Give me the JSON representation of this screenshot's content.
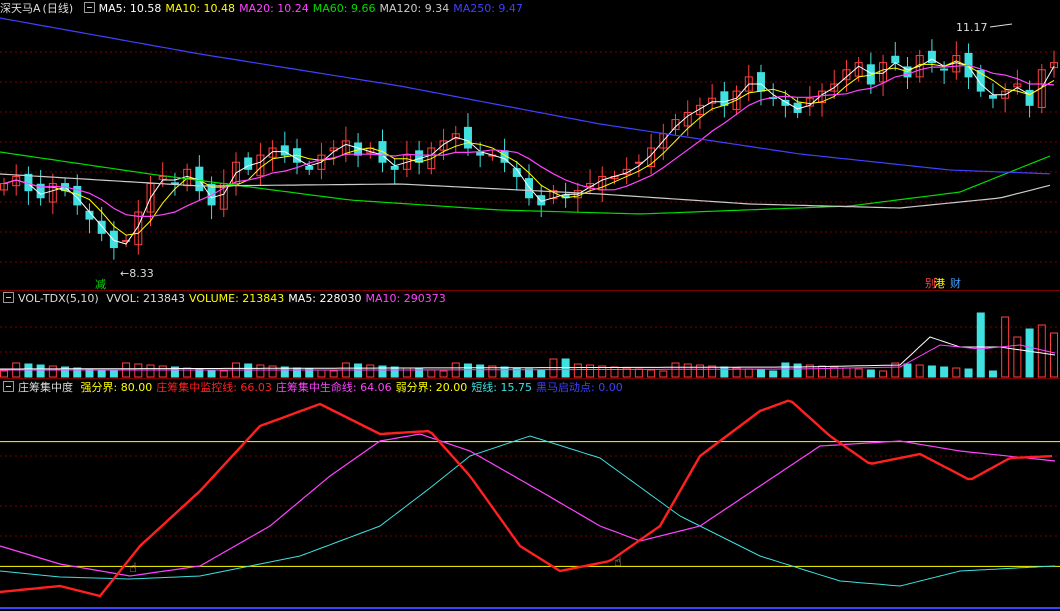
{
  "main_header": {
    "name": "深天马A",
    "period": "(日线)",
    "items": [
      {
        "label": "MA5: 10.58",
        "color": "#ffffff"
      },
      {
        "label": "MA10: 10.48",
        "color": "#ffff00"
      },
      {
        "label": "MA20: 10.24",
        "color": "#ff44ff"
      },
      {
        "label": "MA60: 9.66",
        "color": "#00dd00"
      },
      {
        "label": "MA120: 9.34",
        "color": "#cccccc"
      },
      {
        "label": "MA250: 9.47",
        "color": "#4040ff"
      }
    ]
  },
  "price_annotations": {
    "high": "11.17",
    "low": "8.33",
    "signal_jian": "减",
    "signal_bie": "别",
    "signal_gang": "港",
    "signal_cai": "财"
  },
  "volume_header": {
    "indicator": "VOL-TDX(5,10)",
    "items": [
      {
        "label": "VVOL: 213843",
        "color": "#dddddd"
      },
      {
        "label": "VOLUME: 213843",
        "color": "#ffff00"
      },
      {
        "label": "MA5: 228030",
        "color": "#ffffff"
      },
      {
        "label": "MA10: 290373",
        "color": "#ff44ff"
      }
    ]
  },
  "chip_header": {
    "indicator": "庄筹集中度",
    "items": [
      {
        "label": "强分界:",
        "value": "80.00",
        "color": "#ffff00"
      },
      {
        "label": "庄筹集中监控线:",
        "value": "66.03",
        "color": "#ff2020"
      },
      {
        "label": "庄筹集中生命线:",
        "value": "64.06",
        "color": "#ff44ff"
      },
      {
        "label": "弱分界:",
        "value": "20.00",
        "color": "#ffff00"
      },
      {
        "label": "短线:",
        "value": "15.75",
        "color": "#40e0e0"
      },
      {
        "label": "黑马启动点:",
        "value": "0.00",
        "color": "#4040ff"
      }
    ]
  },
  "colors": {
    "up": "#ff4040",
    "down": "#40e0e0",
    "ma5": "#ffffff",
    "ma10": "#ffff00",
    "ma20": "#ff44ff",
    "ma60": "#00dd00",
    "ma120": "#cccccc",
    "ma250": "#4040ff",
    "grid": "#7a0000"
  },
  "chart_data": [
    {
      "type": "candlestick",
      "title": "深天马A (日线)",
      "ylim": [
        8.0,
        11.6
      ],
      "annotations": [
        {
          "text": "11.17",
          "type": "high"
        },
        {
          "text": "8.33",
          "type": "low"
        }
      ],
      "close_trend": [
        9.3,
        9.4,
        9.2,
        9.1,
        9.3,
        9.2,
        9.0,
        8.8,
        8.6,
        8.4,
        8.5,
        8.9,
        9.3,
        9.4,
        9.3,
        9.5,
        9.2,
        9.0,
        9.3,
        9.6,
        9.5,
        9.7,
        9.8,
        9.7,
        9.6,
        9.5,
        9.7,
        9.8,
        9.9,
        9.7,
        9.8,
        9.6,
        9.5,
        9.7,
        9.6,
        9.8,
        9.9,
        10.0,
        9.8,
        9.7,
        9.7,
        9.6,
        9.4,
        9.1,
        9.0,
        9.2,
        9.1,
        9.2,
        9.3,
        9.4,
        9.4,
        9.5,
        9.6,
        9.8,
        10.0,
        10.2,
        10.3,
        10.4,
        10.5,
        10.4,
        10.6,
        10.8,
        10.6,
        10.5,
        10.4,
        10.3,
        10.5,
        10.6,
        10.7,
        10.9,
        11.0,
        10.7,
        11.0,
        11.0,
        10.8,
        11.1,
        11.0,
        10.9,
        11.1,
        10.8,
        10.6,
        10.5,
        10.6,
        10.7,
        10.4,
        10.9,
        11.0
      ]
    },
    {
      "type": "bar",
      "title": "VOL-TDX(5,10)",
      "series": [
        {
          "name": "VOLUME",
          "last": 213843
        },
        {
          "name": "MA5",
          "last": 228030
        },
        {
          "name": "MA10",
          "last": 290373
        }
      ]
    },
    {
      "type": "line",
      "title": "庄筹集中度",
      "ylim": [
        0,
        100
      ],
      "reference_lines": [
        80,
        20
      ],
      "series": [
        {
          "name": "庄筹集中监控线",
          "last": 66.03
        },
        {
          "name": "庄筹集中生命线",
          "last": 64.06
        },
        {
          "name": "短线",
          "last": 15.75
        },
        {
          "name": "黑马启动点",
          "last": 0.0
        }
      ]
    }
  ]
}
